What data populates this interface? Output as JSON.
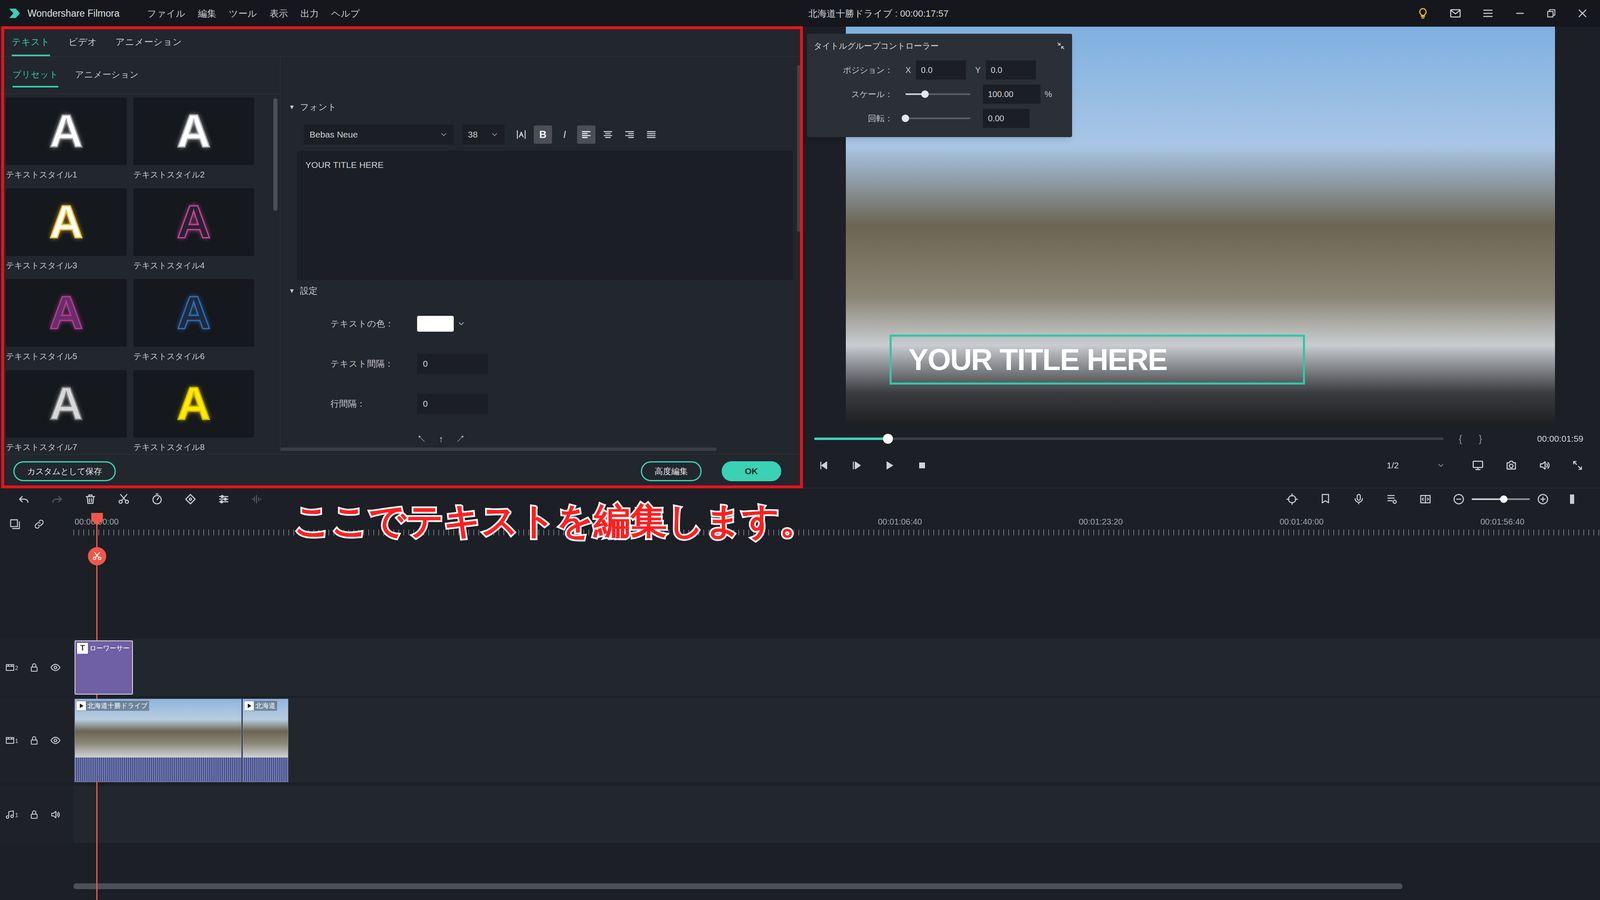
{
  "window": {
    "app_name": "Wondershare Filmora",
    "menu": [
      "ファイル",
      "編集",
      "ツール",
      "表示",
      "出力",
      "ヘルプ"
    ],
    "title": "北海道十勝ドライブ : 00:00:17:57"
  },
  "editor": {
    "tabs": [
      {
        "label": "テキスト",
        "selected": true
      },
      {
        "label": "ビデオ",
        "selected": false
      },
      {
        "label": "アニメーション",
        "selected": false
      }
    ],
    "subtabs": [
      {
        "label": "プリセット",
        "selected": true
      },
      {
        "label": "アニメーション",
        "selected": false
      }
    ],
    "presets": [
      {
        "glyph": "A",
        "label": "テキストスタイル1",
        "color": "#ffffff",
        "outline": "#9a9a9a"
      },
      {
        "glyph": "A",
        "label": "テキストスタイル2",
        "color": "#ffffff",
        "outline": "#b5b5b5"
      },
      {
        "glyph": "A",
        "label": "テキストスタイル3",
        "color": "#ffffff",
        "outline": "#f2c230"
      },
      {
        "glyph": "A",
        "label": "テキストスタイル4",
        "color": "#2a2030",
        "outline": "#c2459a"
      },
      {
        "glyph": "A",
        "label": "テキストスタイル5",
        "color": "#6a2c6e",
        "outline": "#b0408e"
      },
      {
        "glyph": "A",
        "label": "テキストスタイル6",
        "color": "#1e2a40",
        "outline": "#2f6fb0"
      },
      {
        "glyph": "A",
        "label": "テキストスタイル7",
        "color": "#d8d8d8",
        "outline": "#7a7a7a"
      },
      {
        "glyph": "A",
        "label": "テキストスタイル8",
        "color": "#ffea00",
        "outline": "#c9b400"
      }
    ],
    "font": {
      "toggle": "▼",
      "title": "フォント",
      "family": "Bebas Neue",
      "size": "38",
      "styles": [
        {
          "label": "B",
          "selected": true
        },
        {
          "label": "I",
          "selected": false
        }
      ],
      "align": [
        {
          "kind": "left",
          "selected": true
        },
        {
          "kind": "center",
          "selected": false
        },
        {
          "kind": "right",
          "selected": false
        },
        {
          "kind": "justify",
          "selected": false
        }
      ],
      "text": "YOUR TITLE HERE"
    },
    "settings": {
      "toggle": "▼",
      "title": "設定",
      "color_label": "テキストの色：",
      "color": "#ffffff",
      "fields": [
        {
          "label": "テキスト間隔：",
          "value": "0"
        },
        {
          "label": "行間隔：",
          "value": "0"
        }
      ],
      "position_arrows": [
        "↖",
        "↑",
        "↗"
      ]
    },
    "buttons": {
      "save_custom": "カスタムとして保存",
      "advanced": "高度編集",
      "ok": "OK"
    }
  },
  "preview": {
    "title_overlay": "YOUR TITLE HERE",
    "controller": {
      "title": "タイトルグループコントローラー",
      "position_label": "ポジション：",
      "x_label": "X",
      "x": "0.0",
      "y_label": "Y",
      "y": "0.0",
      "scale_label": "スケール：",
      "scale_level": 0.3,
      "scale": "100.00",
      "scale_unit": "%",
      "rotation_label": "回転：",
      "rotation_level": 0,
      "rotation": "0.00"
    },
    "scrubber": {
      "level": 0.117,
      "in_mark": "{",
      "out_mark": "}",
      "timecode": "00:00:01:59"
    },
    "quality": "1/2"
  },
  "timeline": {
    "toolbar": {
      "redo_disabled": true,
      "waveform_disabled": true
    },
    "ruler": [
      "00:00:00:00",
      "00:01:06:40",
      "00:01:23:20",
      "00:01:40:00",
      "00:01:56:40"
    ],
    "zoom_level": 0.55,
    "annotation": "ここでテキストを編集します。",
    "tracks": [
      {
        "kind": "title",
        "number": "2",
        "clips": [
          {
            "icon": "T",
            "label": "ローワーサー"
          }
        ]
      },
      {
        "kind": "video",
        "number": "1",
        "clips": [
          {
            "icon": "",
            "label": "北海道十勝ドライブ"
          },
          {
            "icon": "",
            "label": "北海道"
          }
        ]
      },
      {
        "kind": "audio",
        "number": "1",
        "clips": []
      }
    ]
  }
}
